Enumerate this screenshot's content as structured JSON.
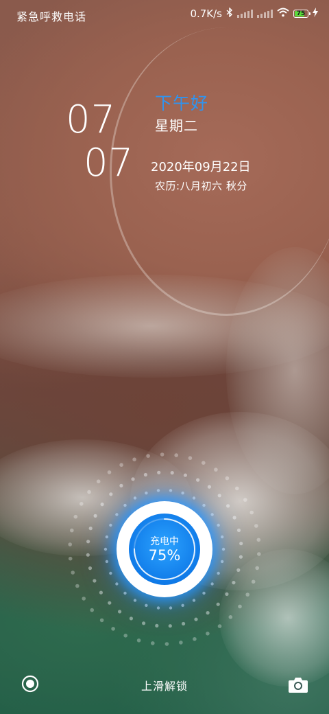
{
  "status_bar": {
    "left_text": "紧急呼救电话",
    "net_speed": "0.7K/s",
    "battery_level": "75",
    "icons": [
      "bluetooth-icon",
      "signal-icon",
      "wifi-icon",
      "battery-icon",
      "charging-bolt-icon"
    ]
  },
  "clock": {
    "hour": "07",
    "minute": "07"
  },
  "greeting": "下午好",
  "weekday": "星期二",
  "date": "2020年09月22日",
  "lunar": "农历:八月初六 秋分",
  "charging": {
    "label": "充电中",
    "percent": "75%",
    "level": 0.75
  },
  "bottom": {
    "unlock_text": "上滑解锁",
    "left_icon": "target-circle-icon",
    "right_icon": "camera-icon"
  },
  "colors": {
    "accent": "#2f94f0",
    "battery_fill": "#5adb3c",
    "charge_blue": "#0f7ae8"
  }
}
